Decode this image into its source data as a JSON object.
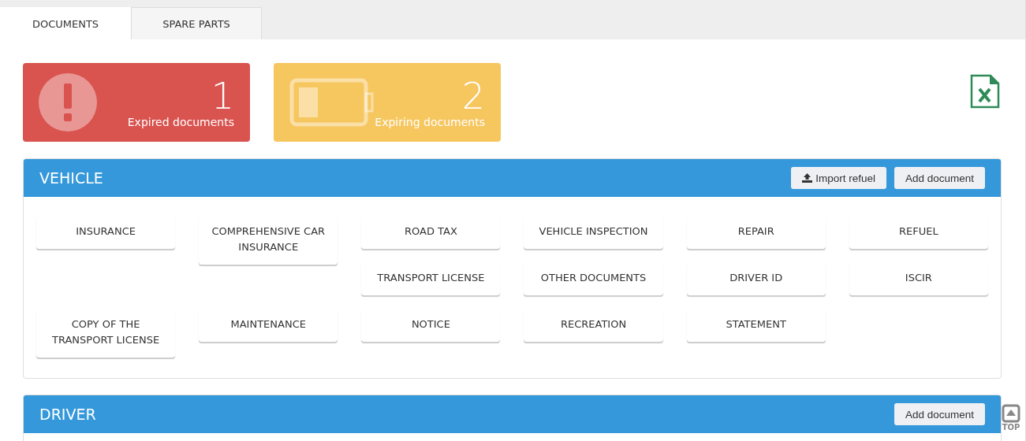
{
  "tabs": [
    {
      "label": "DOCUMENTS",
      "selected": true
    },
    {
      "label": "SPARE PARTS",
      "selected": false
    }
  ],
  "stats": [
    {
      "kind": "expired",
      "count": "1",
      "label": "Expired documents",
      "color": "#d9534f"
    },
    {
      "kind": "expiring",
      "count": "2",
      "label": "Expiring documents",
      "color": "#f6c65f"
    }
  ],
  "sections": [
    {
      "title": "VEHICLE",
      "buttons": [
        {
          "label": "Import refuel",
          "kind": "upload"
        },
        {
          "label": "Add document",
          "kind": "plain"
        }
      ],
      "items": [
        "INSURANCE",
        "COMPREHENSIVE CAR INSURANCE",
        "ROAD TAX",
        "VEHICLE INSPECTION",
        "REPAIR",
        "REFUEL",
        "TRANSPORT LICENSE",
        "OTHER DOCUMENTS",
        "DRIVER ID",
        "ISCIR",
        "COPY OF THE TRANSPORT LICENSE",
        "MAINTENANCE",
        "NOTICE",
        "RECREATION",
        "STATEMENT"
      ]
    },
    {
      "title": "DRIVER",
      "buttons": [
        {
          "label": "Add document",
          "kind": "plain"
        }
      ]
    }
  ],
  "top_button": {
    "label": "TOP"
  }
}
